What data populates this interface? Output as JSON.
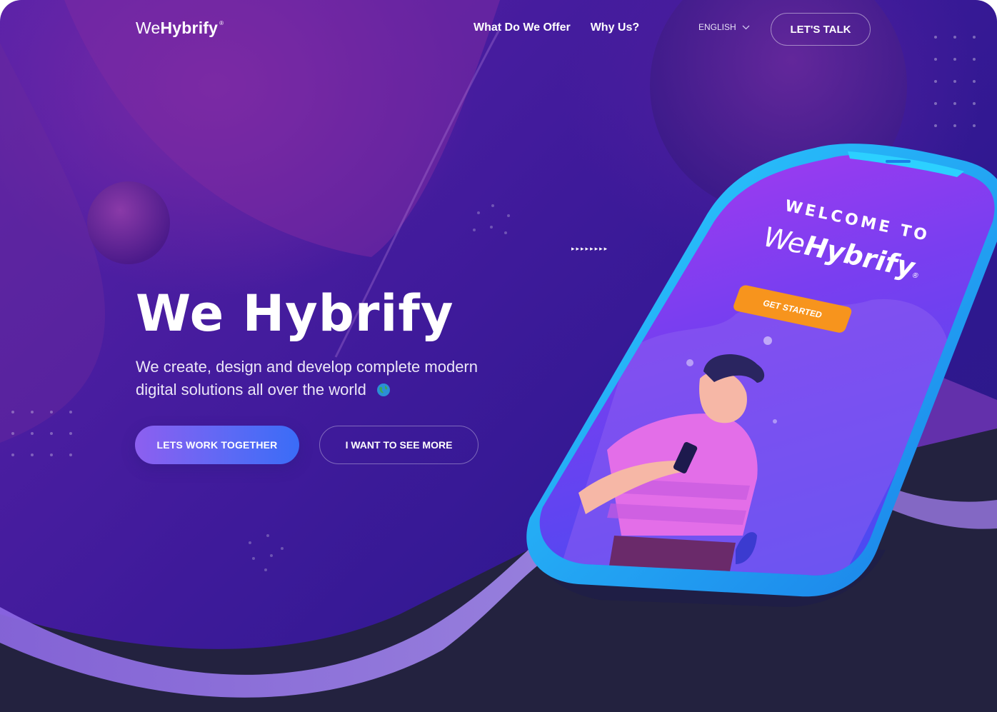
{
  "header": {
    "logo": {
      "light": "We",
      "bold": "Hybrify",
      "mark": "®"
    },
    "nav": [
      {
        "label": "What Do We Offer"
      },
      {
        "label": "Why Us?"
      }
    ],
    "language": {
      "label": "ENGLISH",
      "icon": "chevron-down-icon"
    },
    "cta": "LET'S TALK"
  },
  "hero": {
    "title": "We Hybrify",
    "subtitle": "We create, design and develop complete modern digital solutions all over the world",
    "subtitle_icon": "globe-icon",
    "primary_button": "LETS WORK TOGETHER",
    "secondary_button": "I WANT TO SEE MORE",
    "decor_arrows": "▸▸▸▸▸▸▸▸"
  },
  "phone": {
    "welcome": "WELCOME TO",
    "logo": {
      "light": "We",
      "bold": "Hybrify",
      "mark": "®"
    },
    "button": "GET STARTED"
  },
  "colors": {
    "bg_deep": "#2f1890",
    "bg_purple": "#7a2aa6",
    "floor": "#23223f",
    "accent_blue": "#3a6cf7",
    "accent_orange": "#f7941d",
    "phone_frame": "#1fb8f5"
  }
}
